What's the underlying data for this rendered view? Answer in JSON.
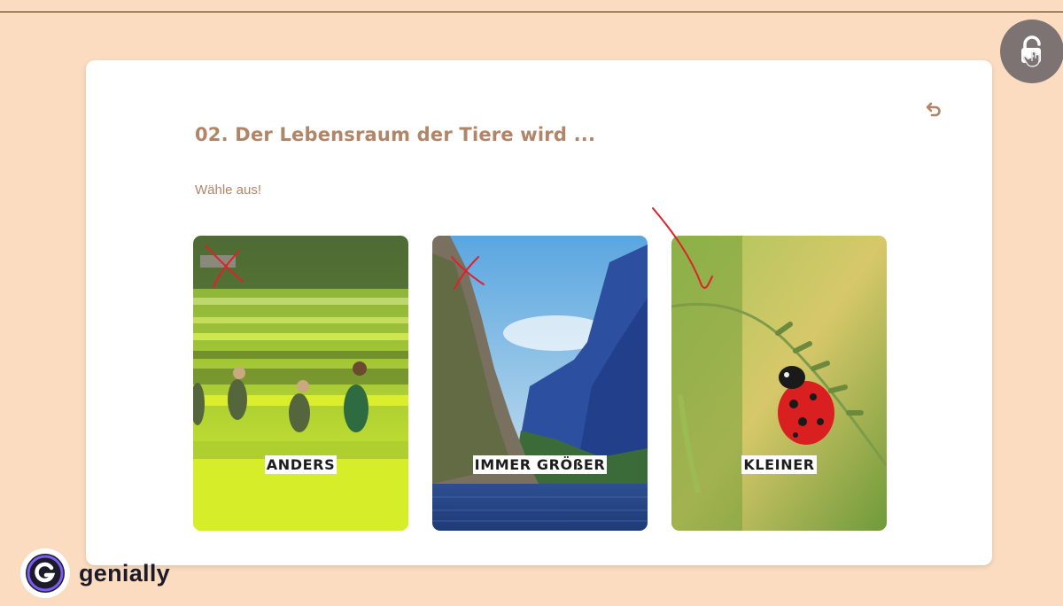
{
  "question": {
    "title": "02. Der Lebensraum der Tiere wird ...",
    "instruction": "Wähle aus!"
  },
  "options": [
    {
      "label": "ANDERS",
      "image": "rice-terraces-scouts",
      "marked": "cross"
    },
    {
      "label": "IMMER GRÖßER",
      "image": "fjord-cliffs",
      "marked": "cross"
    },
    {
      "label": "KLEINER",
      "image": "ladybug-on-grass",
      "marked": "check"
    }
  ],
  "icons": {
    "lock": "unlock-hand-icon",
    "undo": "undo-icon"
  },
  "brand": {
    "name": "genially"
  },
  "colors": {
    "background": "#fbdcc0",
    "accent_text": "#b08568",
    "annotation": "#e0202a",
    "lock_button": "#7c7372"
  }
}
